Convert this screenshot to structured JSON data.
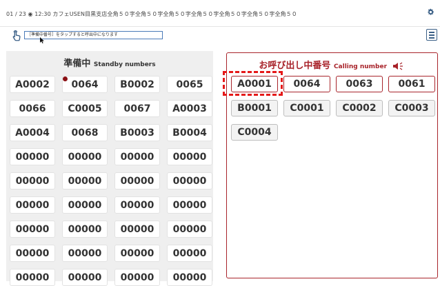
{
  "header": {
    "info": "01 / 23  ◉ 12:30   カフェUSEN目黒支店全角５０字全角５０字全角５０字全角５０字全角５０字全角５０字全角５０"
  },
  "hint": "［準備中番号］をタップすると呼出中になります",
  "standby": {
    "title": "準備中",
    "subtitle": "Standby numbers",
    "numbers": [
      "A0002",
      "0064",
      "B0002",
      "0065",
      "0066",
      "C0005",
      "0067",
      "A0003",
      "A0004",
      "0068",
      "B0003",
      "B0004",
      "00000",
      "00000",
      "00000",
      "00000",
      "00000",
      "00000",
      "00000",
      "00000",
      "00000",
      "00000",
      "00000",
      "00000",
      "00000",
      "00000",
      "00000",
      "00000",
      "00000",
      "00000",
      "00000",
      "00000",
      "00000",
      "00000",
      "00000",
      "00000"
    ]
  },
  "calling": {
    "title": "お呼び出し中番号",
    "subtitle": "Calling number",
    "active": [
      "A0001",
      "0064",
      "0063",
      "0061"
    ],
    "waiting": [
      "B0001",
      "C0001",
      "C0002",
      "C0003",
      "C0004"
    ]
  },
  "icons": {
    "gear": "gear-icon",
    "hand": "tap-hand-icon",
    "calculator": "calculator-icon",
    "speaker": "speaker-icon",
    "cursor": "cursor-icon"
  },
  "colors": {
    "accent": "#a8232a",
    "highlight": "#e51818",
    "panel_bg": "#efefef",
    "header_icon": "#3a5f86"
  }
}
